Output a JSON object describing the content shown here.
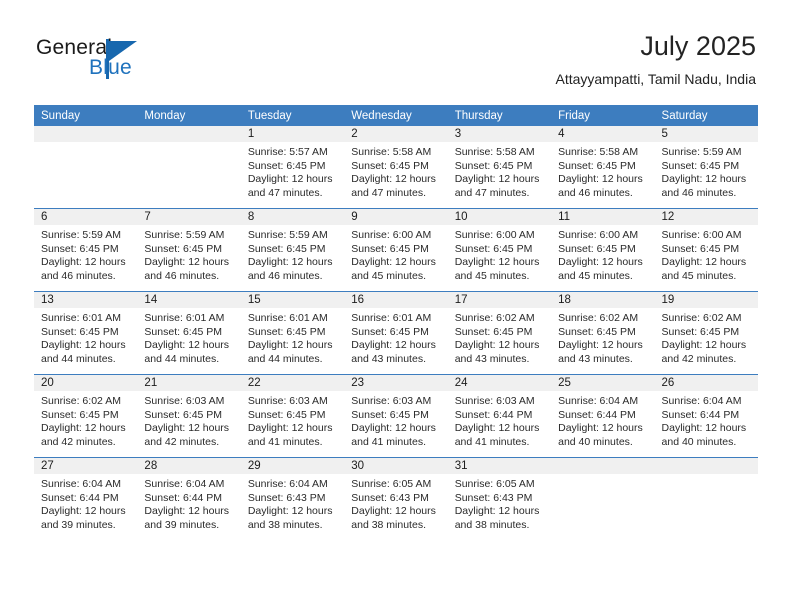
{
  "logo": {
    "word_general": "General",
    "word_blue": "Blue",
    "triangle_icon": "triangle-icon"
  },
  "header": {
    "month_title": "July 2025",
    "location": "Attayyampatti, Tamil Nadu, India"
  },
  "colors": {
    "header_blue": "#3d7dbf",
    "logo_blue": "#1f72bd",
    "daynum_band": "#f0f0f0",
    "text": "#2a2a2a"
  },
  "weekday_headers": [
    "Sunday",
    "Monday",
    "Tuesday",
    "Wednesday",
    "Thursday",
    "Friday",
    "Saturday"
  ],
  "weeks": [
    [
      {
        "day": "",
        "empty": true,
        "sunrise": "",
        "sunset": "",
        "daylight_1": "",
        "daylight_2": ""
      },
      {
        "day": "",
        "empty": true,
        "sunrise": "",
        "sunset": "",
        "daylight_1": "",
        "daylight_2": ""
      },
      {
        "day": "1",
        "sunrise": "Sunrise: 5:57 AM",
        "sunset": "Sunset: 6:45 PM",
        "daylight_1": "Daylight: 12 hours",
        "daylight_2": "and 47 minutes."
      },
      {
        "day": "2",
        "sunrise": "Sunrise: 5:58 AM",
        "sunset": "Sunset: 6:45 PM",
        "daylight_1": "Daylight: 12 hours",
        "daylight_2": "and 47 minutes."
      },
      {
        "day": "3",
        "sunrise": "Sunrise: 5:58 AM",
        "sunset": "Sunset: 6:45 PM",
        "daylight_1": "Daylight: 12 hours",
        "daylight_2": "and 47 minutes."
      },
      {
        "day": "4",
        "sunrise": "Sunrise: 5:58 AM",
        "sunset": "Sunset: 6:45 PM",
        "daylight_1": "Daylight: 12 hours",
        "daylight_2": "and 46 minutes."
      },
      {
        "day": "5",
        "sunrise": "Sunrise: 5:59 AM",
        "sunset": "Sunset: 6:45 PM",
        "daylight_1": "Daylight: 12 hours",
        "daylight_2": "and 46 minutes."
      }
    ],
    [
      {
        "day": "6",
        "sunrise": "Sunrise: 5:59 AM",
        "sunset": "Sunset: 6:45 PM",
        "daylight_1": "Daylight: 12 hours",
        "daylight_2": "and 46 minutes."
      },
      {
        "day": "7",
        "sunrise": "Sunrise: 5:59 AM",
        "sunset": "Sunset: 6:45 PM",
        "daylight_1": "Daylight: 12 hours",
        "daylight_2": "and 46 minutes."
      },
      {
        "day": "8",
        "sunrise": "Sunrise: 5:59 AM",
        "sunset": "Sunset: 6:45 PM",
        "daylight_1": "Daylight: 12 hours",
        "daylight_2": "and 46 minutes."
      },
      {
        "day": "9",
        "sunrise": "Sunrise: 6:00 AM",
        "sunset": "Sunset: 6:45 PM",
        "daylight_1": "Daylight: 12 hours",
        "daylight_2": "and 45 minutes."
      },
      {
        "day": "10",
        "sunrise": "Sunrise: 6:00 AM",
        "sunset": "Sunset: 6:45 PM",
        "daylight_1": "Daylight: 12 hours",
        "daylight_2": "and 45 minutes."
      },
      {
        "day": "11",
        "sunrise": "Sunrise: 6:00 AM",
        "sunset": "Sunset: 6:45 PM",
        "daylight_1": "Daylight: 12 hours",
        "daylight_2": "and 45 minutes."
      },
      {
        "day": "12",
        "sunrise": "Sunrise: 6:00 AM",
        "sunset": "Sunset: 6:45 PM",
        "daylight_1": "Daylight: 12 hours",
        "daylight_2": "and 45 minutes."
      }
    ],
    [
      {
        "day": "13",
        "sunrise": "Sunrise: 6:01 AM",
        "sunset": "Sunset: 6:45 PM",
        "daylight_1": "Daylight: 12 hours",
        "daylight_2": "and 44 minutes."
      },
      {
        "day": "14",
        "sunrise": "Sunrise: 6:01 AM",
        "sunset": "Sunset: 6:45 PM",
        "daylight_1": "Daylight: 12 hours",
        "daylight_2": "and 44 minutes."
      },
      {
        "day": "15",
        "sunrise": "Sunrise: 6:01 AM",
        "sunset": "Sunset: 6:45 PM",
        "daylight_1": "Daylight: 12 hours",
        "daylight_2": "and 44 minutes."
      },
      {
        "day": "16",
        "sunrise": "Sunrise: 6:01 AM",
        "sunset": "Sunset: 6:45 PM",
        "daylight_1": "Daylight: 12 hours",
        "daylight_2": "and 43 minutes."
      },
      {
        "day": "17",
        "sunrise": "Sunrise: 6:02 AM",
        "sunset": "Sunset: 6:45 PM",
        "daylight_1": "Daylight: 12 hours",
        "daylight_2": "and 43 minutes."
      },
      {
        "day": "18",
        "sunrise": "Sunrise: 6:02 AM",
        "sunset": "Sunset: 6:45 PM",
        "daylight_1": "Daylight: 12 hours",
        "daylight_2": "and 43 minutes."
      },
      {
        "day": "19",
        "sunrise": "Sunrise: 6:02 AM",
        "sunset": "Sunset: 6:45 PM",
        "daylight_1": "Daylight: 12 hours",
        "daylight_2": "and 42 minutes."
      }
    ],
    [
      {
        "day": "20",
        "sunrise": "Sunrise: 6:02 AM",
        "sunset": "Sunset: 6:45 PM",
        "daylight_1": "Daylight: 12 hours",
        "daylight_2": "and 42 minutes."
      },
      {
        "day": "21",
        "sunrise": "Sunrise: 6:03 AM",
        "sunset": "Sunset: 6:45 PM",
        "daylight_1": "Daylight: 12 hours",
        "daylight_2": "and 42 minutes."
      },
      {
        "day": "22",
        "sunrise": "Sunrise: 6:03 AM",
        "sunset": "Sunset: 6:45 PM",
        "daylight_1": "Daylight: 12 hours",
        "daylight_2": "and 41 minutes."
      },
      {
        "day": "23",
        "sunrise": "Sunrise: 6:03 AM",
        "sunset": "Sunset: 6:45 PM",
        "daylight_1": "Daylight: 12 hours",
        "daylight_2": "and 41 minutes."
      },
      {
        "day": "24",
        "sunrise": "Sunrise: 6:03 AM",
        "sunset": "Sunset: 6:44 PM",
        "daylight_1": "Daylight: 12 hours",
        "daylight_2": "and 41 minutes."
      },
      {
        "day": "25",
        "sunrise": "Sunrise: 6:04 AM",
        "sunset": "Sunset: 6:44 PM",
        "daylight_1": "Daylight: 12 hours",
        "daylight_2": "and 40 minutes."
      },
      {
        "day": "26",
        "sunrise": "Sunrise: 6:04 AM",
        "sunset": "Sunset: 6:44 PM",
        "daylight_1": "Daylight: 12 hours",
        "daylight_2": "and 40 minutes."
      }
    ],
    [
      {
        "day": "27",
        "sunrise": "Sunrise: 6:04 AM",
        "sunset": "Sunset: 6:44 PM",
        "daylight_1": "Daylight: 12 hours",
        "daylight_2": "and 39 minutes."
      },
      {
        "day": "28",
        "sunrise": "Sunrise: 6:04 AM",
        "sunset": "Sunset: 6:44 PM",
        "daylight_1": "Daylight: 12 hours",
        "daylight_2": "and 39 minutes."
      },
      {
        "day": "29",
        "sunrise": "Sunrise: 6:04 AM",
        "sunset": "Sunset: 6:43 PM",
        "daylight_1": "Daylight: 12 hours",
        "daylight_2": "and 38 minutes."
      },
      {
        "day": "30",
        "sunrise": "Sunrise: 6:05 AM",
        "sunset": "Sunset: 6:43 PM",
        "daylight_1": "Daylight: 12 hours",
        "daylight_2": "and 38 minutes."
      },
      {
        "day": "31",
        "sunrise": "Sunrise: 6:05 AM",
        "sunset": "Sunset: 6:43 PM",
        "daylight_1": "Daylight: 12 hours",
        "daylight_2": "and 38 minutes."
      },
      {
        "day": "",
        "empty": true,
        "sunrise": "",
        "sunset": "",
        "daylight_1": "",
        "daylight_2": ""
      },
      {
        "day": "",
        "empty": true,
        "sunrise": "",
        "sunset": "",
        "daylight_1": "",
        "daylight_2": ""
      }
    ]
  ]
}
